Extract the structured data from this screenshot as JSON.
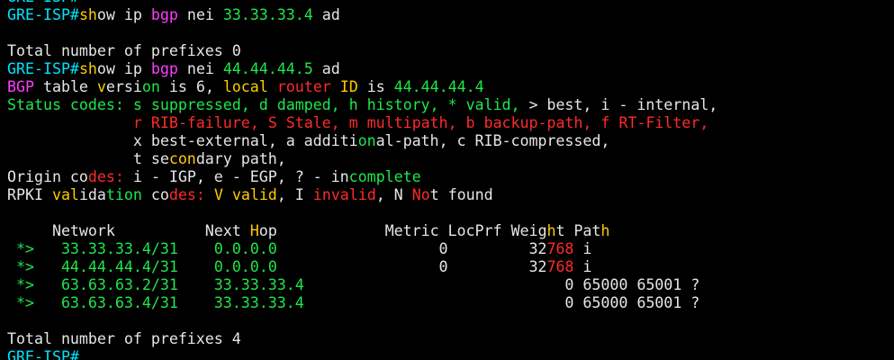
{
  "palette": {
    "default": "#e6e6e6",
    "cyan": "#00e5ff",
    "green": "#1ee84a",
    "magenta": "#ff3cff",
    "red": "#ff2a2a",
    "yellow": "#ffcc00",
    "background": "#000000"
  },
  "terminal": {
    "lines": [
      [
        {
          "t": "GRE-ISP#",
          "c": "cyan"
        }
      ],
      [
        {
          "t": "GRE-ISP#",
          "c": "cyan"
        },
        {
          "t": "sh",
          "c": "yellow"
        },
        {
          "t": "ow ip ",
          "c": "default"
        },
        {
          "t": "bgp",
          "c": "magenta"
        },
        {
          "t": " nei ",
          "c": "default"
        },
        {
          "t": "33.33.33.4",
          "c": "green"
        },
        {
          "t": " ad",
          "c": "default"
        }
      ],
      [
        {
          "t": "",
          "c": "default"
        }
      ],
      [
        {
          "t": "Total number of prefixes 0",
          "c": "default"
        }
      ],
      [
        {
          "t": "GRE-ISP#",
          "c": "cyan"
        },
        {
          "t": "sh",
          "c": "yellow"
        },
        {
          "t": "ow ip ",
          "c": "default"
        },
        {
          "t": "bgp",
          "c": "magenta"
        },
        {
          "t": " nei ",
          "c": "default"
        },
        {
          "t": "44.44.44.5",
          "c": "green"
        },
        {
          "t": " ad",
          "c": "default"
        }
      ],
      [
        {
          "t": "BGP",
          "c": "magenta"
        },
        {
          "t": " table ",
          "c": "default"
        },
        {
          "t": "v",
          "c": "yellow"
        },
        {
          "t": "ersi",
          "c": "default"
        },
        {
          "t": "on",
          "c": "green"
        },
        {
          "t": " is 6, ",
          "c": "default"
        },
        {
          "t": "local",
          "c": "yellow"
        },
        {
          "t": " ",
          "c": "default"
        },
        {
          "t": "router",
          "c": "red"
        },
        {
          "t": " ",
          "c": "default"
        },
        {
          "t": "ID",
          "c": "yellow"
        },
        {
          "t": " is ",
          "c": "default"
        },
        {
          "t": "44.44.44.4",
          "c": "green"
        }
      ],
      [
        {
          "t": "Status codes: s suppressed, d damped, h history, * valid, ",
          "c": "green"
        },
        {
          "t": "> best, i - internal,",
          "c": "default"
        }
      ],
      [
        {
          "t": "              ",
          "c": "default"
        },
        {
          "t": "r RIB-failure, S Stale, m multipath, b backup-path, f RT-Filter,",
          "c": "red"
        }
      ],
      [
        {
          "t": "              x best-external, a additi",
          "c": "default"
        },
        {
          "t": "on",
          "c": "green"
        },
        {
          "t": "al-path, c RIB-compressed,",
          "c": "default"
        }
      ],
      [
        {
          "t": "              t se",
          "c": "default"
        },
        {
          "t": "con",
          "c": "yellow"
        },
        {
          "t": "dary path,",
          "c": "default"
        }
      ],
      [
        {
          "t": "Origin co",
          "c": "default"
        },
        {
          "t": "des:",
          "c": "red"
        },
        {
          "t": " i - IGP, e - EGP, ? - in",
          "c": "default"
        },
        {
          "t": "complete",
          "c": "green"
        }
      ],
      [
        {
          "t": "RPKI ",
          "c": "default"
        },
        {
          "t": "val",
          "c": "yellow"
        },
        {
          "t": "ida",
          "c": "default"
        },
        {
          "t": "tion",
          "c": "green"
        },
        {
          "t": " co",
          "c": "default"
        },
        {
          "t": "des:",
          "c": "red"
        },
        {
          "t": " ",
          "c": "default"
        },
        {
          "t": "V",
          "c": "yellow"
        },
        {
          "t": " ",
          "c": "default"
        },
        {
          "t": "valid",
          "c": "yellow"
        },
        {
          "t": ", I ",
          "c": "default"
        },
        {
          "t": "invalid",
          "c": "red"
        },
        {
          "t": ", N ",
          "c": "default"
        },
        {
          "t": "No",
          "c": "red"
        },
        {
          "t": "t found",
          "c": "default"
        }
      ],
      [
        {
          "t": "",
          "c": "default"
        }
      ],
      [
        {
          "t": "     Network          Next ",
          "c": "default"
        },
        {
          "t": "H",
          "c": "yellow"
        },
        {
          "t": "op            Metric LocPrf Weig",
          "c": "default"
        },
        {
          "t": "h",
          "c": "yellow"
        },
        {
          "t": "t Pat",
          "c": "default"
        },
        {
          "t": "h",
          "c": "yellow"
        }
      ],
      [
        {
          "t": " *>   33.33.33.4/31    0.0.0.0",
          "c": "green"
        },
        {
          "t": "                  0         32",
          "c": "default"
        },
        {
          "t": "768",
          "c": "red"
        },
        {
          "t": " i",
          "c": "default"
        }
      ],
      [
        {
          "t": " *>   44.44.44.4/31    0.0.0.0",
          "c": "green"
        },
        {
          "t": "                  0         32",
          "c": "default"
        },
        {
          "t": "768",
          "c": "red"
        },
        {
          "t": " i",
          "c": "default"
        }
      ],
      [
        {
          "t": " *>   63.63.63.2/31    33.33.33.4",
          "c": "green"
        },
        {
          "t": "                             0 65000 65001 ?",
          "c": "default"
        }
      ],
      [
        {
          "t": " *>   63.63.63.4/31    33.33.33.4",
          "c": "green"
        },
        {
          "t": "                             0 65000 65001 ?",
          "c": "default"
        }
      ],
      [
        {
          "t": "",
          "c": "default"
        }
      ],
      [
        {
          "t": "Total number of prefixes 4",
          "c": "default"
        }
      ],
      [
        {
          "t": "GRE-ISP#",
          "c": "cyan"
        }
      ]
    ]
  }
}
